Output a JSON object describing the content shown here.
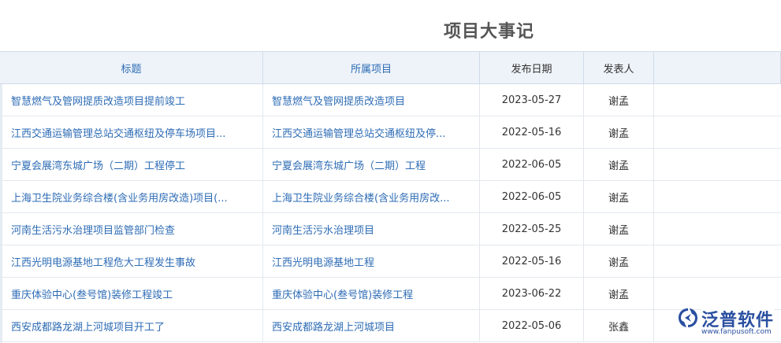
{
  "page": {
    "title": "项目大事记"
  },
  "table": {
    "columns": [
      "标题",
      "所属项目",
      "发布日期",
      "发表人"
    ],
    "rows": [
      {
        "title": "智慧燃气及管网提质改造项目提前竣工",
        "project": "智慧燃气及管网提质改造项目",
        "date": "2023-05-27",
        "author": "谢孟"
      },
      {
        "title": "江西交通运输管理总站交通枢纽及停车场项目...",
        "project": "江西交通运输管理总站交通枢纽及停...",
        "date": "2022-05-16",
        "author": "谢孟"
      },
      {
        "title": "宁夏会展湾东城广场（二期）工程停工",
        "project": "宁夏会展湾东城广场（二期）工程",
        "date": "2022-06-05",
        "author": "谢孟"
      },
      {
        "title": "上海卫生院业务综合楼(含业务用房改造)项目(...",
        "project": "上海卫生院业务综合楼(含业务用房改...",
        "date": "2022-06-05",
        "author": "谢孟"
      },
      {
        "title": "河南生活污水治理项目监管部门检查",
        "project": "河南生活污水治理项目",
        "date": "2022-05-25",
        "author": "谢孟"
      },
      {
        "title": "江西光明电源基地工程危大工程发生事故",
        "project": "江西光明电源基地工程",
        "date": "2022-05-16",
        "author": "谢孟"
      },
      {
        "title": "重庆体验中心(叁号馆)装修工程竣工",
        "project": "重庆体验中心(叁号馆)装修工程",
        "date": "2023-06-22",
        "author": "谢孟"
      },
      {
        "title": "西安成都路龙湖上河城项目开工了",
        "project": "西安成都路龙湖上河城项目",
        "date": "2022-05-06",
        "author": "张鑫"
      }
    ]
  },
  "logo": {
    "name": "泛普软件",
    "url": "www.fanpusoft.com",
    "icon": "fanpu-logo-icon",
    "color": "#2a4fa0"
  }
}
